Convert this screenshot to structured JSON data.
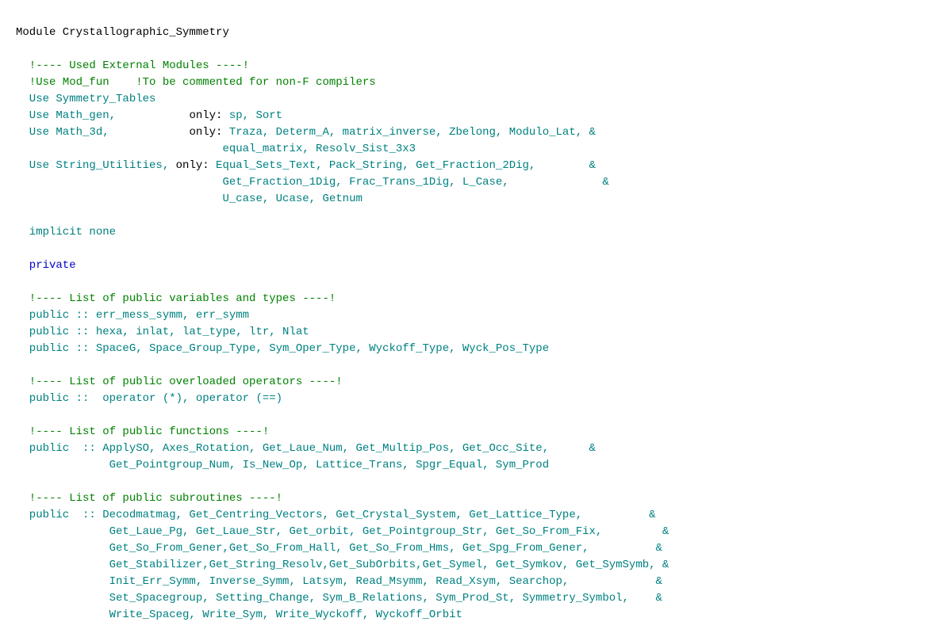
{
  "title": "Module Crystallographic_Symmetry",
  "code": {
    "module_line": "Module Crystallographic_Symmetry",
    "lines": [
      {
        "type": "blank"
      },
      {
        "type": "comment",
        "text": "!---- Used External Modules ----!"
      },
      {
        "type": "comment_special",
        "text": "!Use Mod_fun    !To be commented for non-F compilers"
      },
      {
        "type": "use",
        "color": "teal",
        "text": "Use Symmetry_Tables"
      },
      {
        "type": "use",
        "color": "teal",
        "text": "Use Math_gen,           only: sp, Sort"
      },
      {
        "type": "use",
        "color": "teal",
        "text": "Use Math_3d,            only: Traza, Determ_A, matrix_inverse, Zbelong, Modulo_Lat, &"
      },
      {
        "type": "use_cont",
        "color": "teal",
        "text": "                               equal_matrix, Resolv_Sist_3x3"
      },
      {
        "type": "use",
        "color": "teal",
        "text": "Use String_Utilities, only: Equal_Sets_Text, Pack_String, Get_Fraction_2Dig,        &"
      },
      {
        "type": "use_cont",
        "color": "teal",
        "text": "                               Get_Fraction_1Dig, Frac_Trans_1Dig, L_Case,              &"
      },
      {
        "type": "use_cont",
        "color": "teal",
        "text": "                               U_case, Ucase, Getnum"
      },
      {
        "type": "blank"
      },
      {
        "type": "keyword",
        "color": "teal",
        "text": "implicit none"
      },
      {
        "type": "blank"
      },
      {
        "type": "keyword",
        "color": "blue",
        "text": "private"
      },
      {
        "type": "blank"
      },
      {
        "type": "comment",
        "text": "!---- List of public variables and types ----!"
      },
      {
        "type": "public",
        "color": "teal",
        "text": "public :: err_mess_symm, err_symm"
      },
      {
        "type": "public",
        "color": "teal",
        "text": "public :: hexa, inlat, lat_type, ltr, Nlat"
      },
      {
        "type": "public",
        "color": "teal",
        "text": "public :: SpaceG, Space_Group_Type, Sym_Oper_Type, Wyckoff_Type, Wyck_Pos_Type"
      },
      {
        "type": "blank"
      },
      {
        "type": "comment",
        "text": "!---- List of public overloaded operators ----!"
      },
      {
        "type": "public",
        "color": "teal",
        "text": "public ::  operator (*), operator (==)"
      },
      {
        "type": "blank"
      },
      {
        "type": "comment",
        "text": "!---- List of public functions ----!"
      },
      {
        "type": "public",
        "color": "teal",
        "text": "public  :: ApplySO, Axes_Rotation, Get_Laue_Num, Get_Multip_Pos, Get_Occ_Site,      &"
      },
      {
        "type": "use_cont",
        "color": "teal",
        "text": "            Get_Pointgroup_Num, Is_New_Op, Lattice_Trans, Spgr_Equal, Sym_Prod"
      },
      {
        "type": "blank"
      },
      {
        "type": "comment",
        "text": "!---- List of public subroutines ----!"
      },
      {
        "type": "public",
        "color": "teal",
        "text": "public  :: Decodmatmag, Get_Centring_Vectors, Get_Crystal_System, Get_Lattice_Type,          &"
      },
      {
        "type": "use_cont",
        "color": "teal",
        "text": "            Get_Laue_Pg, Get_Laue_Str, Get_orbit, Get_Pointgroup_Str, Get_So_From_Fix,         &"
      },
      {
        "type": "use_cont",
        "color": "teal",
        "text": "            Get_So_From_Gener,Get_So_From_Hall, Get_So_From_Hms, Get_Spg_From_Gener,          &"
      },
      {
        "type": "use_cont",
        "color": "teal",
        "text": "            Get_Stabilizer,Get_String_Resolv,Get_SubOrbits,Get_Symel, Get_Symkov, Get_SymSymb, &"
      },
      {
        "type": "use_cont",
        "color": "teal",
        "text": "            Init_Err_Symm, Inverse_Symm, Latsym, Read_Msymm, Read_Xsym, Searchop,             &"
      },
      {
        "type": "use_cont",
        "color": "teal",
        "text": "            Set_Spacegroup, Setting_Change, Sym_B_Relations, Sym_Prod_St, Symmetry_Symbol,    &"
      },
      {
        "type": "use_cont",
        "color": "teal",
        "text": "            Write_Spaceg, Write_Sym, Write_Wyckoff, Wyckoff_Orbit"
      }
    ]
  }
}
